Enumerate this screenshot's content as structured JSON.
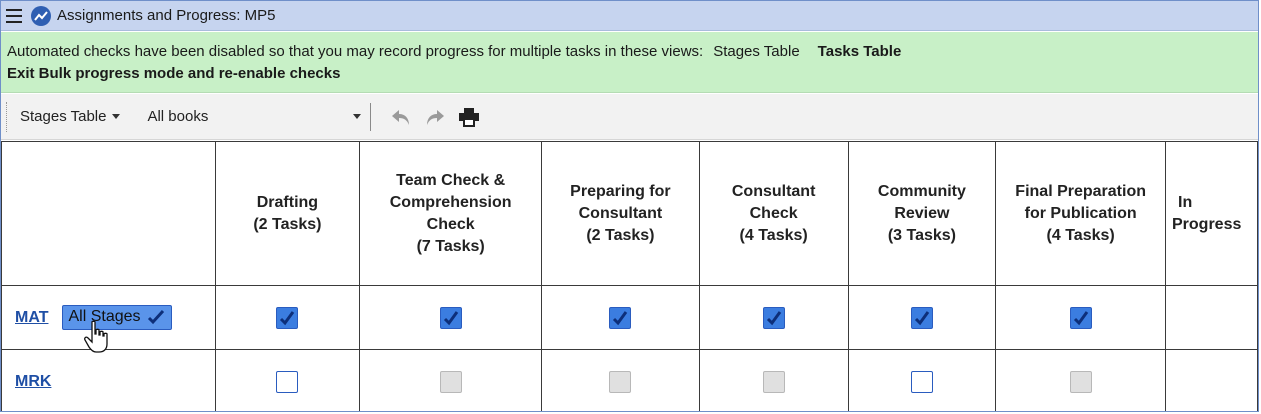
{
  "window": {
    "title": "Assignments and Progress: MP5"
  },
  "banner": {
    "message": "Automated checks have been disabled so that you may record progress for multiple tasks in these views:",
    "view_stages": "Stages Table",
    "view_tasks": "Tasks Table",
    "exit_link": "Exit Bulk progress mode and re-enable checks"
  },
  "toolbar": {
    "view_select": "Stages Table",
    "book_filter": "All books",
    "icons": [
      "undo-icon",
      "redo-icon",
      "print-icon"
    ]
  },
  "table": {
    "columns": [
      {
        "line1": "",
        "line2": "",
        "line3": "",
        "line4": ""
      },
      {
        "line1": "Drafting",
        "line2": "(2 Tasks)",
        "line3": "",
        "line4": ""
      },
      {
        "line1": "Team Check &",
        "line2": "Comprehension",
        "line3": "Check",
        "line4": "(7 Tasks)"
      },
      {
        "line1": "Preparing for",
        "line2": "Consultant",
        "line3": "(2 Tasks)",
        "line4": ""
      },
      {
        "line1": "Consultant",
        "line2": "Check",
        "line3": "(4 Tasks)",
        "line4": ""
      },
      {
        "line1": "Community",
        "line2": "Review",
        "line3": "(3 Tasks)",
        "line4": ""
      },
      {
        "line1": "Final Preparation",
        "line2": "for Publication",
        "line3": "(4 Tasks)",
        "line4": ""
      },
      {
        "line1": "In",
        "line2": "Progress",
        "line3": "",
        "line4": ""
      }
    ],
    "rows": [
      {
        "book": "MAT",
        "all_stages_label": "All Stages",
        "cells": [
          "checked",
          "checked",
          "checked",
          "checked",
          "checked",
          "checked"
        ]
      },
      {
        "book": "MRK",
        "cells": [
          "unchecked",
          "disabled",
          "disabled",
          "disabled",
          "unchecked",
          "disabled"
        ]
      }
    ]
  }
}
